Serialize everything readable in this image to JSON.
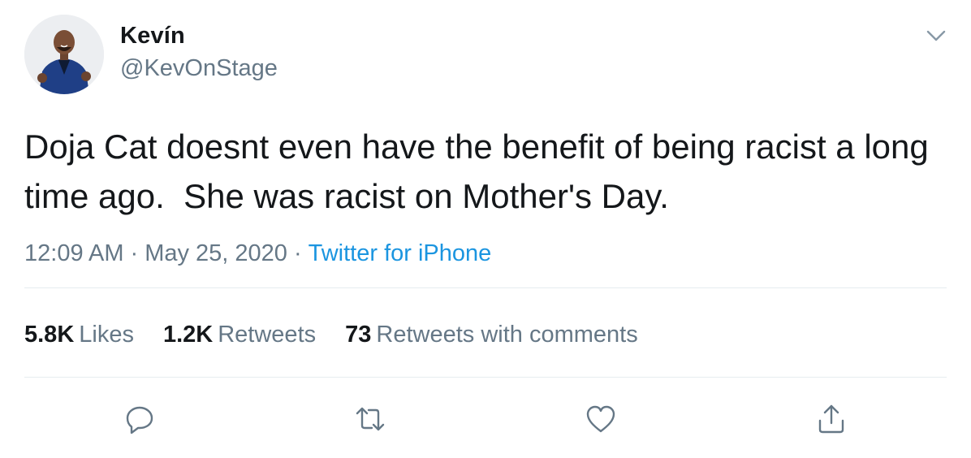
{
  "author": {
    "display_name": "Kevín",
    "handle": "@KevOnStage"
  },
  "tweet": {
    "text": "Doja Cat doesnt even have the benefit of being racist a long time ago.  She was racist on Mother's Day.",
    "time": "12:09 AM",
    "date": "May 25, 2020",
    "separator": "·",
    "source": "Twitter for iPhone"
  },
  "stats": [
    {
      "count": "5.8K",
      "label": "Likes"
    },
    {
      "count": "1.2K",
      "label": "Retweets"
    },
    {
      "count": "73",
      "label": "Retweets with comments"
    }
  ],
  "icons": {
    "caret": "chevron-down-icon",
    "reply": "reply-icon",
    "retweet": "retweet-icon",
    "like": "heart-icon",
    "share": "share-icon"
  },
  "colors": {
    "text": "#14171a",
    "secondary": "#657786",
    "link": "#1b95e0",
    "divider": "#e6ecf0"
  }
}
